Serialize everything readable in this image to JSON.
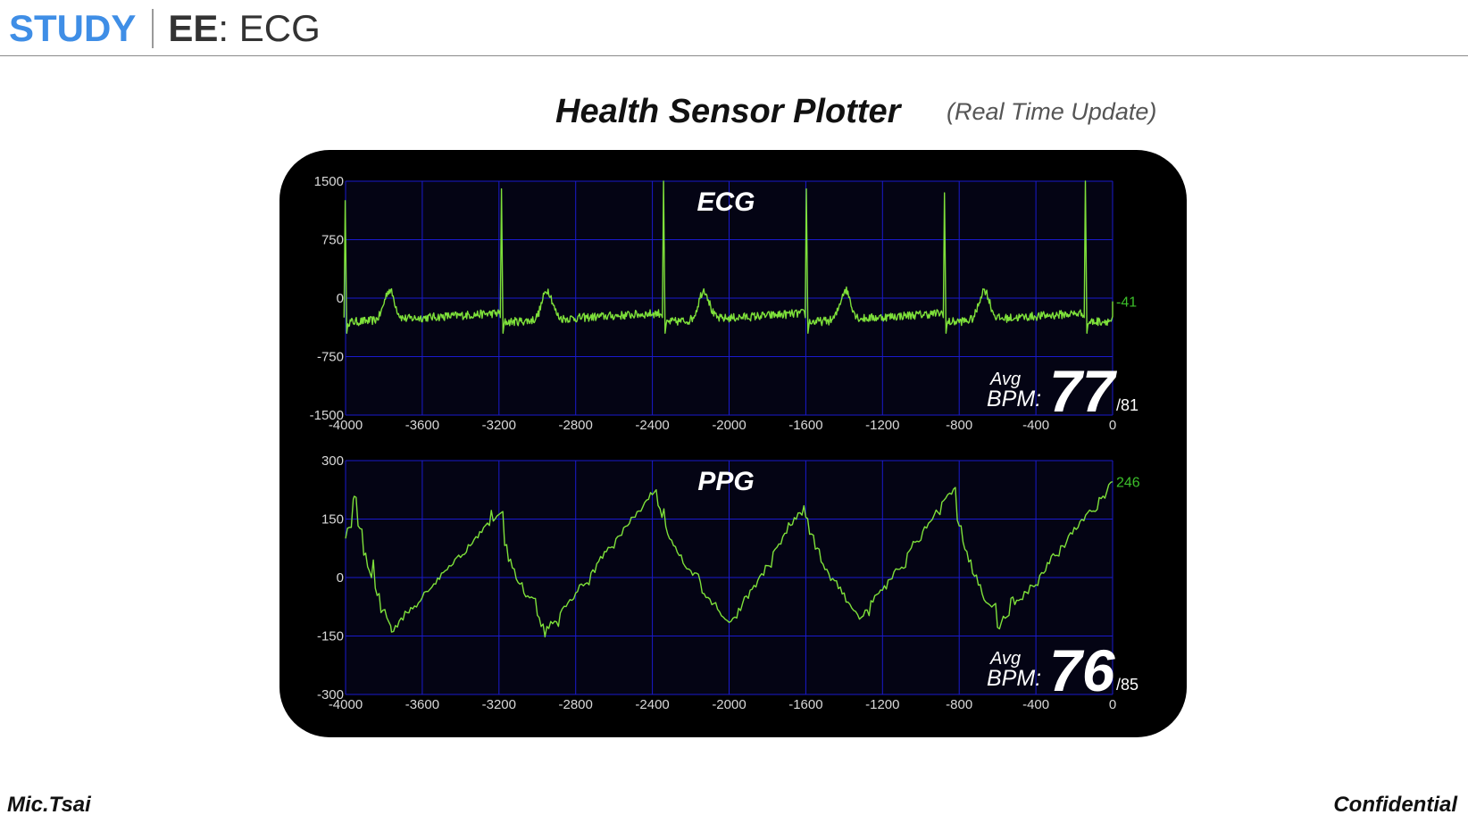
{
  "header": {
    "brand_study": "STUDY",
    "brand_ee": "EE",
    "brand_rest": ": ECG"
  },
  "title": "Health Sensor Plotter",
  "subtitle": "(Real Time Update)",
  "footer": {
    "author": "Mic.Tsai",
    "confidential": "Confidential"
  },
  "colors": {
    "brand": "#3f8ee6",
    "trace": "#7ee03a",
    "grid": "#1a1acc",
    "plot_bg": "#040414",
    "panel": "#000000"
  },
  "chart_data": [
    {
      "type": "line",
      "title": "ECG",
      "xlim": [
        -4000,
        0
      ],
      "ylim": [
        -1500,
        1500
      ],
      "xticks": [
        -4000,
        -3600,
        -3200,
        -2800,
        -2400,
        -2000,
        -1600,
        -1200,
        -800,
        -400,
        0
      ],
      "yticks": [
        1500,
        750,
        0,
        -750,
        -1500
      ],
      "grid": true,
      "current_value": -41,
      "avg_label": "Avg",
      "bpm_label": "BPM:",
      "avg_bpm": 77,
      "bpm_max": 81,
      "series": [
        {
          "beats": [
            -4000,
            -3185,
            -2340,
            -1595,
            -875,
            -140
          ],
          "peaks": [
            1250,
            1400,
            1580,
            1400,
            1350,
            1580
          ],
          "spike_width": 12,
          "dip_after": -450,
          "t_wave_amp": 380,
          "baseline": -250,
          "noise": 110
        }
      ]
    },
    {
      "type": "line",
      "title": "PPG",
      "xlim": [
        -4000,
        0
      ],
      "ylim": [
        -300,
        300
      ],
      "xticks": [
        -4000,
        -3600,
        -3200,
        -2800,
        -2400,
        -2000,
        -1600,
        -1200,
        -800,
        -400,
        0
      ],
      "yticks": [
        300,
        150,
        0,
        -150,
        -300
      ],
      "grid": true,
      "current_value": 246,
      "avg_label": "Avg",
      "bpm_label": "BPM:",
      "avg_bpm": 76,
      "bpm_max": 85,
      "series": [
        {
          "peaks": [
            [
              -3955,
              215
            ],
            [
              -3200,
              165
            ],
            [
              -2380,
              230
            ],
            [
              -1610,
              190
            ],
            [
              -830,
              230
            ]
          ],
          "troughs": [
            [
              -3760,
              -135
            ],
            [
              -2960,
              -135
            ],
            [
              -2000,
              -120
            ],
            [
              -1320,
              -105
            ],
            [
              -600,
              -125
            ]
          ],
          "start": [
            -4000,
            95
          ],
          "end": [
            0,
            246
          ],
          "noise": 14
        }
      ]
    }
  ]
}
